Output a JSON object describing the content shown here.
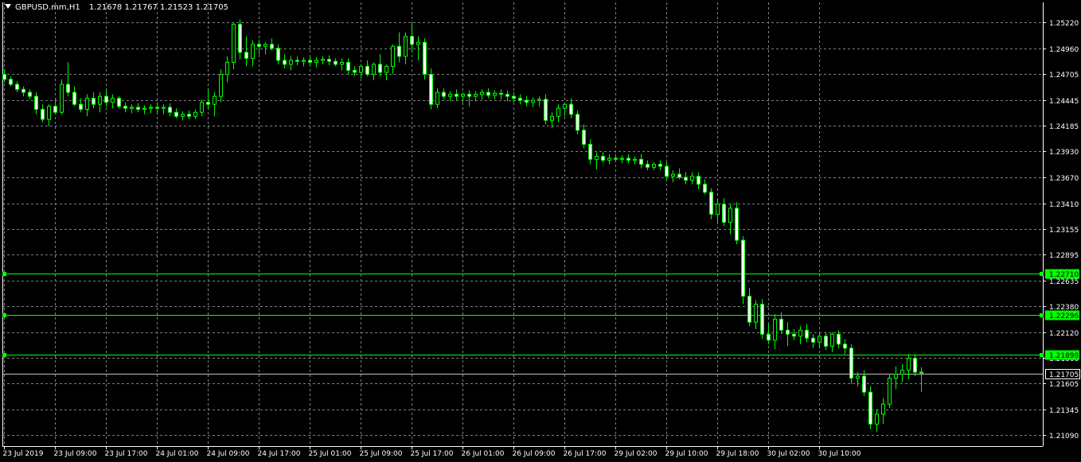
{
  "chart_data": {
    "type": "candlestick",
    "symbol": "GBPUSD.mm,H1",
    "ohlc_readout": {
      "open": "1.21678",
      "high": "1.21767",
      "low": "1.21523",
      "close": "1.21705"
    },
    "y_tick_labels": [
      "1.25220",
      "1.24960",
      "1.24705",
      "1.24445",
      "1.24185",
      "1.23930",
      "1.23670",
      "1.23410",
      "1.23155",
      "1.22895",
      "1.22635",
      "1.22380",
      "1.22120",
      "1.21860",
      "1.21605",
      "1.21345",
      "1.21090"
    ],
    "ylim": [
      1.2098,
      1.2542
    ],
    "x_tick_labels": [
      "23 Jul 2019",
      "23 Jul 09:00",
      "23 Jul 17:00",
      "24 Jul 01:00",
      "24 Jul 09:00",
      "24 Jul 17:00",
      "25 Jul 01:00",
      "25 Jul 09:00",
      "25 Jul 17:00",
      "26 Jul 01:00",
      "26 Jul 09:00",
      "26 Jul 17:00",
      "29 Jul 02:00",
      "29 Jul 10:00",
      "29 Jul 18:00",
      "30 Jul 02:00",
      "30 Jul 10:00"
    ],
    "bars_per_tick": 8,
    "grid": true,
    "colors": {
      "background": "#000000",
      "grid": "#808080",
      "axis_text": "#ffffff",
      "bull_body": "#000000",
      "bear_body": "#ffffff",
      "candle_outline": "#00ff00",
      "wick": "#00ff00",
      "level_line": "#00ff00",
      "level_tag": "#00ff00",
      "level_tag_text": "#000000",
      "bid_line": "#c0c0c0",
      "bid_tag": "#000000",
      "bid_tag_text": "#ffffff"
    },
    "horizontal_levels": [
      {
        "value": 1.2271,
        "label": "1.22710"
      },
      {
        "value": 1.22296,
        "label": "1.22296"
      },
      {
        "value": 1.21898,
        "label": "1.21898"
      }
    ],
    "bid_line": {
      "value": 1.21705,
      "label": "1.21705"
    },
    "candles": [
      [
        1.247,
        1.2475,
        1.2462,
        1.2465
      ],
      [
        1.2465,
        1.2468,
        1.2458,
        1.246
      ],
      [
        1.246,
        1.2463,
        1.2452,
        1.2455
      ],
      [
        1.2455,
        1.2458,
        1.2448,
        1.2452
      ],
      [
        1.2452,
        1.2455,
        1.2445,
        1.2448
      ],
      [
        1.2448,
        1.2452,
        1.243,
        1.2435
      ],
      [
        1.2435,
        1.244,
        1.2422,
        1.2425
      ],
      [
        1.2425,
        1.244,
        1.2418,
        1.2438
      ],
      [
        1.2438,
        1.2445,
        1.243,
        1.2432
      ],
      [
        1.2432,
        1.2465,
        1.243,
        1.246
      ],
      [
        1.246,
        1.2482,
        1.2448,
        1.2452
      ],
      [
        1.2452,
        1.2458,
        1.2438,
        1.244
      ],
      [
        1.244,
        1.2446,
        1.2432,
        1.2435
      ],
      [
        1.2435,
        1.245,
        1.2428,
        1.2446
      ],
      [
        1.2446,
        1.2452,
        1.2436,
        1.244
      ],
      [
        1.244,
        1.2452,
        1.2432,
        1.2448
      ],
      [
        1.2448,
        1.2455,
        1.2438,
        1.2442
      ],
      [
        1.2442,
        1.245,
        1.2436,
        1.2446
      ],
      [
        1.2446,
        1.2448,
        1.2436,
        1.2438
      ],
      [
        1.2438,
        1.2442,
        1.2432,
        1.2436
      ],
      [
        1.2436,
        1.244,
        1.2431,
        1.2437
      ],
      [
        1.2437,
        1.2441,
        1.2432,
        1.2435
      ],
      [
        1.2435,
        1.2439,
        1.243,
        1.2436
      ],
      [
        1.2436,
        1.244,
        1.2431,
        1.2437
      ],
      [
        1.2437,
        1.2442,
        1.2431,
        1.2436
      ],
      [
        1.2436,
        1.244,
        1.243,
        1.2437
      ],
      [
        1.2437,
        1.2441,
        1.2428,
        1.2432
      ],
      [
        1.2432,
        1.2436,
        1.2426,
        1.2428
      ],
      [
        1.2428,
        1.2433,
        1.2424,
        1.243
      ],
      [
        1.243,
        1.2434,
        1.2425,
        1.2428
      ],
      [
        1.2428,
        1.2435,
        1.2425,
        1.2432
      ],
      [
        1.2432,
        1.2445,
        1.2428,
        1.2442
      ],
      [
        1.2442,
        1.2455,
        1.2435,
        1.244
      ],
      [
        1.244,
        1.2452,
        1.2428,
        1.2448
      ],
      [
        1.2448,
        1.2475,
        1.2442,
        1.247
      ],
      [
        1.247,
        1.2488,
        1.2462,
        1.2482
      ],
      [
        1.2482,
        1.2522,
        1.2475,
        1.252
      ],
      [
        1.252,
        1.2525,
        1.2485,
        1.2492
      ],
      [
        1.2492,
        1.2508,
        1.2478,
        1.2486
      ],
      [
        1.2486,
        1.2504,
        1.2478,
        1.25
      ],
      [
        1.25,
        1.2505,
        1.249,
        1.2498
      ],
      [
        1.2498,
        1.2502,
        1.249,
        1.25
      ],
      [
        1.25,
        1.2506,
        1.2494,
        1.2496
      ],
      [
        1.2496,
        1.25,
        1.248,
        1.2484
      ],
      [
        1.2484,
        1.249,
        1.2476,
        1.248
      ],
      [
        1.248,
        1.2488,
        1.2474,
        1.2484
      ],
      [
        1.2484,
        1.2488,
        1.2479,
        1.2483
      ],
      [
        1.2483,
        1.2487,
        1.2478,
        1.2484
      ],
      [
        1.2484,
        1.2488,
        1.2479,
        1.2482
      ],
      [
        1.2482,
        1.2487,
        1.2477,
        1.2484
      ],
      [
        1.2484,
        1.2488,
        1.248,
        1.2485
      ],
      [
        1.2485,
        1.2489,
        1.2479,
        1.2483
      ],
      [
        1.2483,
        1.2486,
        1.2478,
        1.248
      ],
      [
        1.248,
        1.2486,
        1.2474,
        1.2482
      ],
      [
        1.2482,
        1.2486,
        1.247,
        1.2474
      ],
      [
        1.2474,
        1.2478,
        1.2468,
        1.2472
      ],
      [
        1.2472,
        1.248,
        1.2466,
        1.2478
      ],
      [
        1.2478,
        1.2484,
        1.2468,
        1.247
      ],
      [
        1.247,
        1.2482,
        1.2464,
        1.248
      ],
      [
        1.248,
        1.249,
        1.2468,
        1.2472
      ],
      [
        1.2472,
        1.248,
        1.2464,
        1.2478
      ],
      [
        1.2478,
        1.25,
        1.247,
        1.2498
      ],
      [
        1.2498,
        1.2512,
        1.2482,
        1.2488
      ],
      [
        1.2488,
        1.2512,
        1.248,
        1.2508
      ],
      [
        1.2508,
        1.2522,
        1.2492,
        1.25
      ],
      [
        1.25,
        1.2508,
        1.2484,
        1.2502
      ],
      [
        1.2502,
        1.2506,
        1.2465,
        1.247
      ],
      [
        1.247,
        1.2476,
        1.2435,
        1.244
      ],
      [
        1.244,
        1.2456,
        1.2436,
        1.2452
      ],
      [
        1.2452,
        1.2456,
        1.2445,
        1.2448
      ],
      [
        1.2448,
        1.2453,
        1.2443,
        1.245
      ],
      [
        1.245,
        1.2455,
        1.2444,
        1.2448
      ],
      [
        1.2448,
        1.2452,
        1.2442,
        1.245
      ],
      [
        1.245,
        1.2454,
        1.2438,
        1.2448
      ],
      [
        1.2448,
        1.2453,
        1.2443,
        1.245
      ],
      [
        1.245,
        1.2455,
        1.2445,
        1.2452
      ],
      [
        1.2452,
        1.2456,
        1.2446,
        1.2449
      ],
      [
        1.2449,
        1.2454,
        1.2445,
        1.2451
      ],
      [
        1.2451,
        1.2455,
        1.2445,
        1.245
      ],
      [
        1.245,
        1.2454,
        1.2443,
        1.2448
      ],
      [
        1.2448,
        1.2452,
        1.2442,
        1.2446
      ],
      [
        1.2446,
        1.245,
        1.244,
        1.2444
      ],
      [
        1.2444,
        1.2448,
        1.2438,
        1.2442
      ],
      [
        1.2442,
        1.2447,
        1.2437,
        1.2444
      ],
      [
        1.2444,
        1.2448,
        1.2438,
        1.2445
      ],
      [
        1.2445,
        1.245,
        1.242,
        1.2424
      ],
      [
        1.2424,
        1.2432,
        1.2416,
        1.2428
      ],
      [
        1.2428,
        1.244,
        1.2422,
        1.2436
      ],
      [
        1.2436,
        1.2442,
        1.2428,
        1.244
      ],
      [
        1.244,
        1.2446,
        1.2426,
        1.243
      ],
      [
        1.243,
        1.2434,
        1.241,
        1.2414
      ],
      [
        1.2414,
        1.242,
        1.2396,
        1.24
      ],
      [
        1.24,
        1.2405,
        1.238,
        1.2385
      ],
      [
        1.2385,
        1.2392,
        1.2375,
        1.2388
      ],
      [
        1.2388,
        1.2392,
        1.2382,
        1.2384
      ],
      [
        1.2384,
        1.239,
        1.238,
        1.2386
      ],
      [
        1.2386,
        1.239,
        1.2382,
        1.2385
      ],
      [
        1.2385,
        1.2389,
        1.2381,
        1.2386
      ],
      [
        1.2386,
        1.239,
        1.2381,
        1.2384
      ],
      [
        1.2384,
        1.2388,
        1.238,
        1.2385
      ],
      [
        1.2385,
        1.239,
        1.2376,
        1.238
      ],
      [
        1.238,
        1.2384,
        1.2374,
        1.2377
      ],
      [
        1.2377,
        1.2382,
        1.2374,
        1.238
      ],
      [
        1.238,
        1.2384,
        1.2374,
        1.2378
      ],
      [
        1.2378,
        1.2382,
        1.2365,
        1.2368
      ],
      [
        1.2368,
        1.2374,
        1.2362,
        1.237
      ],
      [
        1.237,
        1.2376,
        1.2365,
        1.2367
      ],
      [
        1.2367,
        1.2372,
        1.236,
        1.2364
      ],
      [
        1.2364,
        1.2372,
        1.236,
        1.2368
      ],
      [
        1.2368,
        1.2372,
        1.2355,
        1.236
      ],
      [
        1.236,
        1.2365,
        1.235,
        1.2352
      ],
      [
        1.2352,
        1.2356,
        1.2325,
        1.233
      ],
      [
        1.233,
        1.2345,
        1.2322,
        1.234
      ],
      [
        1.234,
        1.2346,
        1.2318,
        1.2322
      ],
      [
        1.2322,
        1.234,
        1.231,
        1.2336
      ],
      [
        1.2336,
        1.2342,
        1.23,
        1.2304
      ],
      [
        1.2304,
        1.2308,
        1.224,
        1.2248
      ],
      [
        1.2248,
        1.2256,
        1.2218,
        1.2222
      ],
      [
        1.2222,
        1.2244,
        1.2215,
        1.224
      ],
      [
        1.224,
        1.2245,
        1.2205,
        1.221
      ],
      [
        1.221,
        1.222,
        1.22,
        1.2204
      ],
      [
        1.2204,
        1.223,
        1.2195,
        1.2225
      ],
      [
        1.2225,
        1.2232,
        1.221,
        1.2214
      ],
      [
        1.2214,
        1.2222,
        1.2198,
        1.221
      ],
      [
        1.221,
        1.2215,
        1.2204,
        1.2208
      ],
      [
        1.2208,
        1.2218,
        1.22,
        1.2214
      ],
      [
        1.2214,
        1.222,
        1.2202,
        1.2206
      ],
      [
        1.2206,
        1.221,
        1.2196,
        1.2202
      ],
      [
        1.2202,
        1.2212,
        1.2196,
        1.2208
      ],
      [
        1.2208,
        1.2212,
        1.2194,
        1.2198
      ],
      [
        1.2198,
        1.2212,
        1.2192,
        1.221
      ],
      [
        1.221,
        1.2214,
        1.2196,
        1.22
      ],
      [
        1.22,
        1.2205,
        1.219,
        1.2196
      ],
      [
        1.2196,
        1.22,
        1.216,
        1.2166
      ],
      [
        1.2166,
        1.2172,
        1.2158,
        1.2168
      ],
      [
        1.2168,
        1.2174,
        1.2148,
        1.2152
      ],
      [
        1.2152,
        1.2158,
        1.2115,
        1.212
      ],
      [
        1.212,
        1.2135,
        1.2112,
        1.213
      ],
      [
        1.213,
        1.2146,
        1.212,
        1.214
      ],
      [
        1.214,
        1.217,
        1.2136,
        1.2166
      ],
      [
        1.2166,
        1.2178,
        1.2155,
        1.217
      ],
      [
        1.217,
        1.218,
        1.2162,
        1.2174
      ],
      [
        1.2174,
        1.219,
        1.2165,
        1.2186
      ],
      [
        1.2186,
        1.219,
        1.2168,
        1.2172
      ],
      [
        1.2172,
        1.2177,
        1.2152,
        1.2171
      ]
    ]
  }
}
